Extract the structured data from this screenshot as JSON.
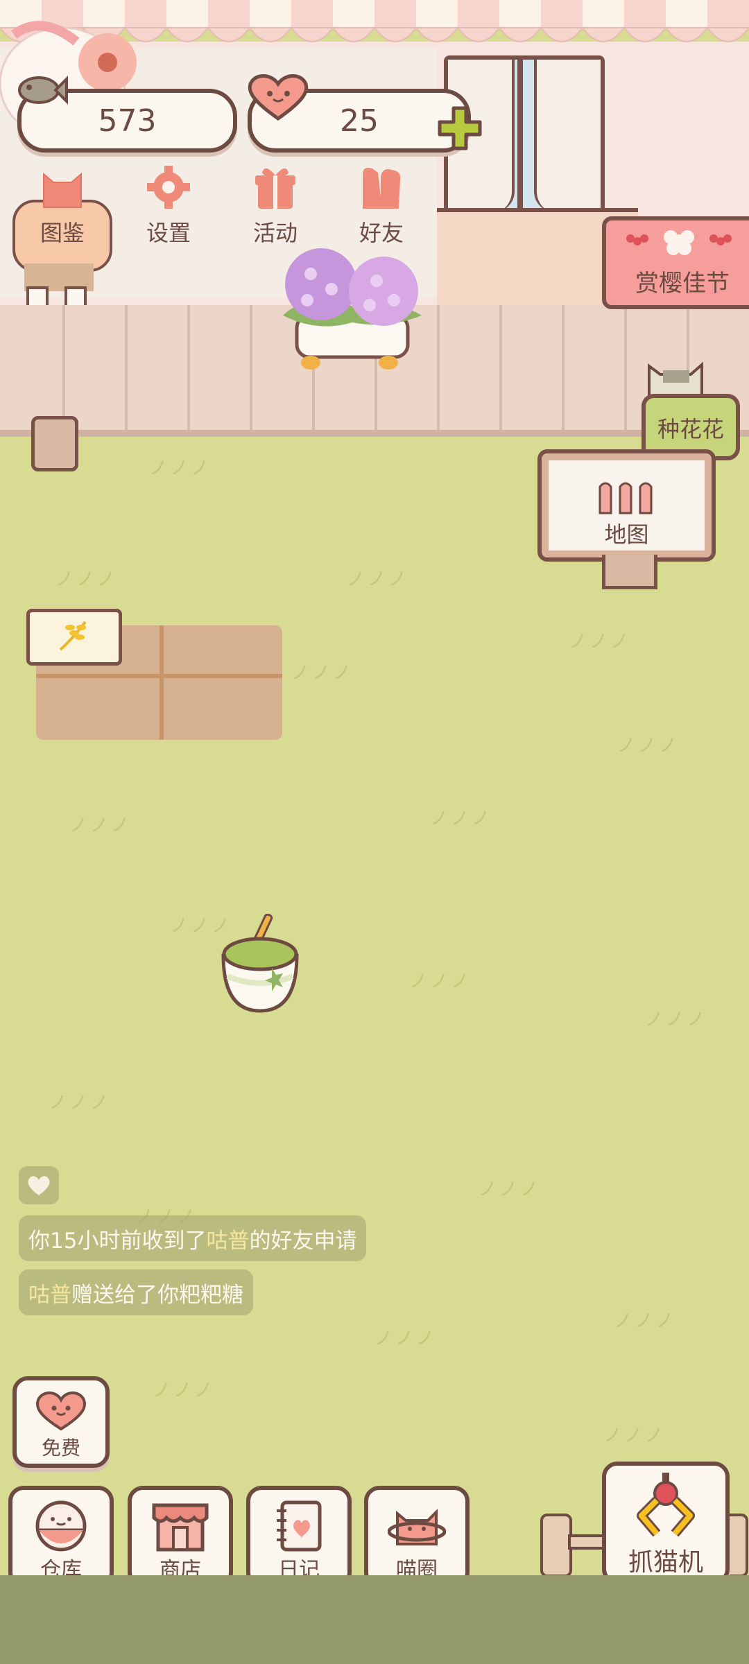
{
  "hud": {
    "fish_count": "573",
    "heart_count": "25"
  },
  "top_menu": {
    "items": [
      {
        "label": "图鉴",
        "icon": "cat-head-icon"
      },
      {
        "label": "设置",
        "icon": "gear-icon"
      },
      {
        "label": "活动",
        "icon": "gift-icon"
      },
      {
        "label": "好友",
        "icon": "friends-icon"
      }
    ]
  },
  "event_sign": {
    "label": "赏樱佳节"
  },
  "plant_button": {
    "label": "种花花"
  },
  "map_sign": {
    "label": "地图"
  },
  "chat": {
    "messages": [
      {
        "prefix": "你15小时前收到了",
        "name": "咕普",
        "suffix": "的好友申请"
      },
      {
        "prefix": "",
        "name": "咕普",
        "suffix": "赠送给了你粑粑糖"
      }
    ]
  },
  "free_button": {
    "label": "免费"
  },
  "bottom_nav": {
    "items": [
      {
        "label": "仓库",
        "icon": "warehouse-icon"
      },
      {
        "label": "商店",
        "icon": "shop-icon"
      },
      {
        "label": "日记",
        "icon": "diary-icon"
      },
      {
        "label": "喵圈",
        "icon": "cat-planet-icon"
      }
    ]
  },
  "claw_button": {
    "label": "抓猫机"
  },
  "colors": {
    "grass": "#d8db92",
    "outline": "#6d4a42",
    "accent_pink": "#f39a8c",
    "accent_green": "#c7d57a"
  }
}
